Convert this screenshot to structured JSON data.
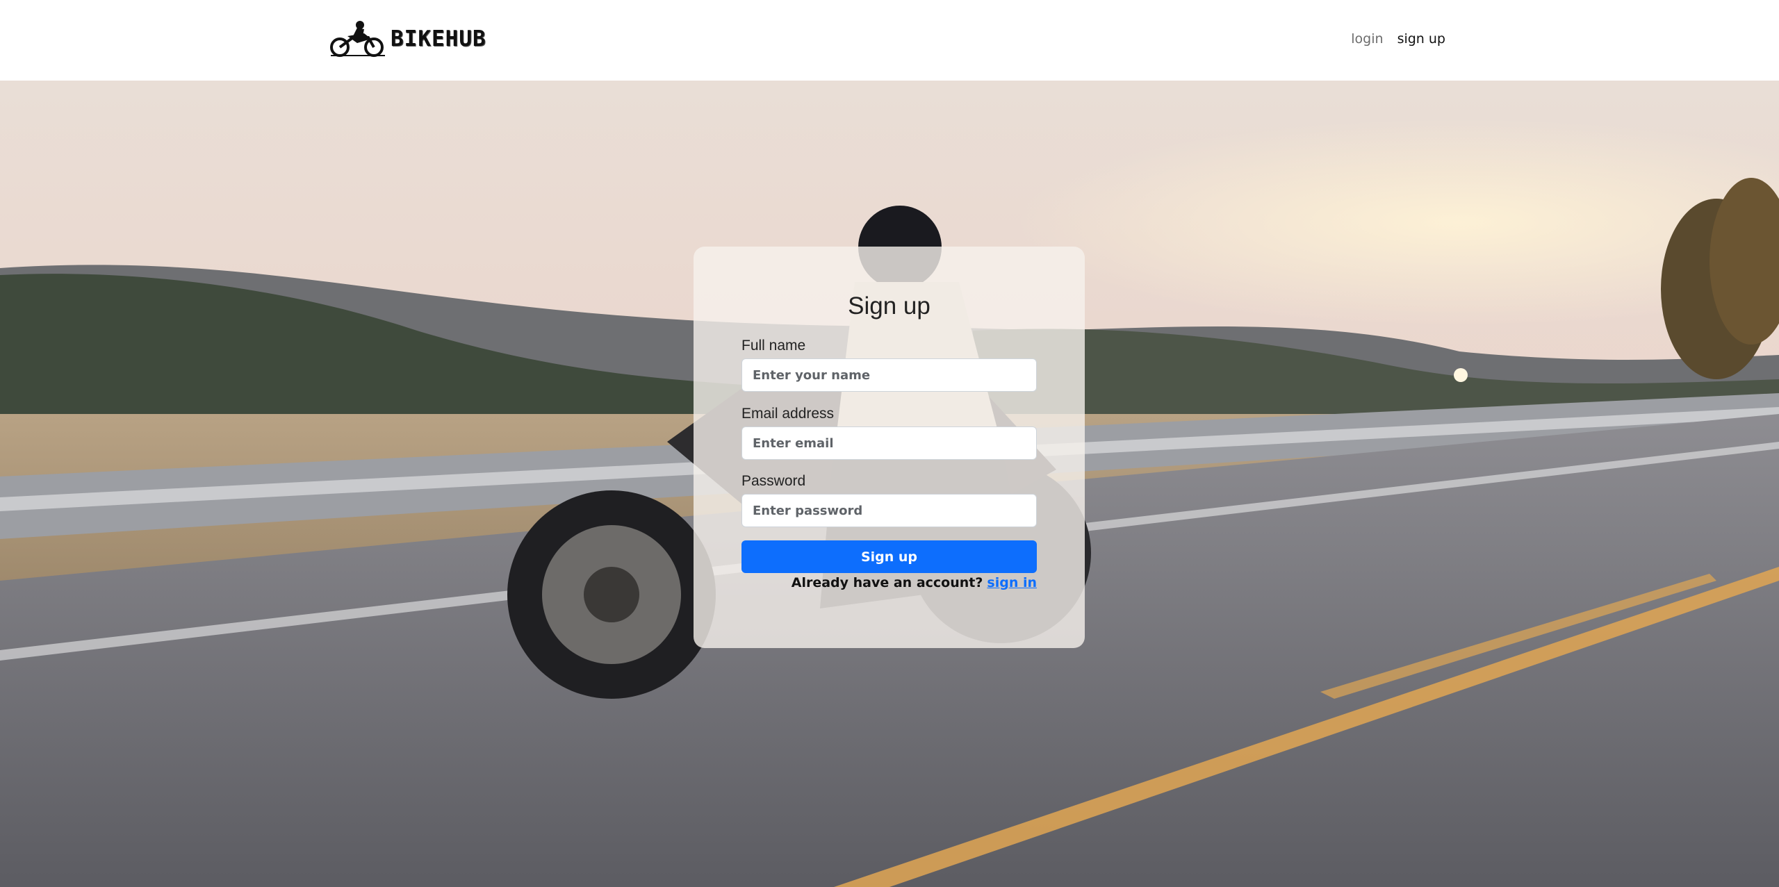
{
  "header": {
    "brand_name": "BIKEHUB",
    "logo_icon": "motorcycle-rider-icon",
    "nav": {
      "login_label": "login",
      "signup_label": "sign up"
    }
  },
  "form": {
    "title": "Sign up",
    "full_name": {
      "label": "Full name",
      "placeholder": "Enter your name",
      "value": ""
    },
    "email": {
      "label": "Email address",
      "placeholder": "Enter email",
      "value": ""
    },
    "password": {
      "label": "Password",
      "placeholder": "Enter password",
      "value": ""
    },
    "submit_label": "Sign up",
    "switch_prompt": "Already have an account?",
    "switch_link": "sign in"
  },
  "colors": {
    "primary": "#0d6efd",
    "card_background": "#f6f1ec"
  }
}
